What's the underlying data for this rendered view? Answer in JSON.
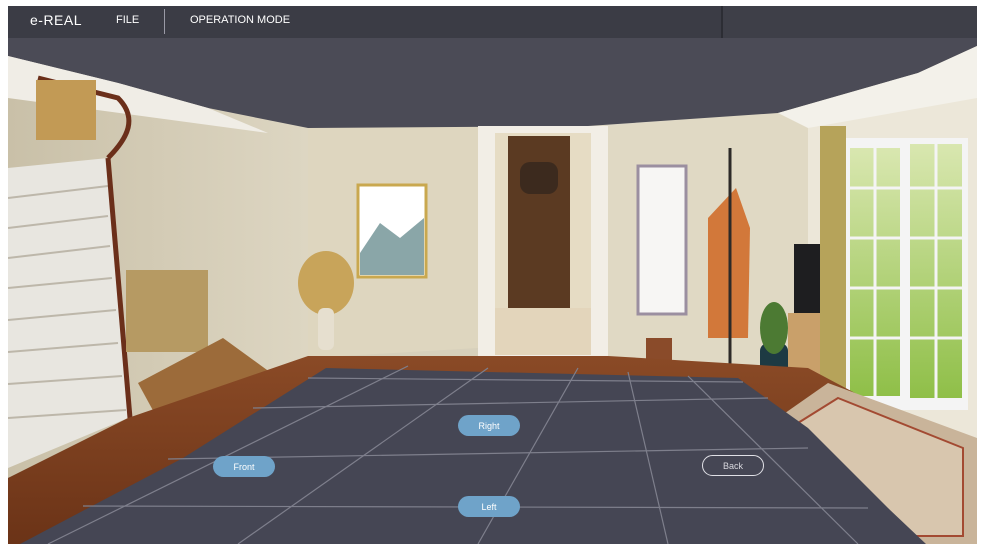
{
  "app": {
    "logo": "e-REAL"
  },
  "menu": {
    "file": "FILE",
    "operation_mode": "OPERATION MODE"
  },
  "nav": {
    "right": "Right",
    "front": "Front",
    "back": "Back",
    "left": "Left"
  },
  "colors": {
    "topbar": "#3b3c45",
    "ceiling": "#4b4b56",
    "floor_grid": "#454654",
    "button": "#6fa3c9"
  },
  "icons": {
    "logo": "e-real-logo"
  }
}
